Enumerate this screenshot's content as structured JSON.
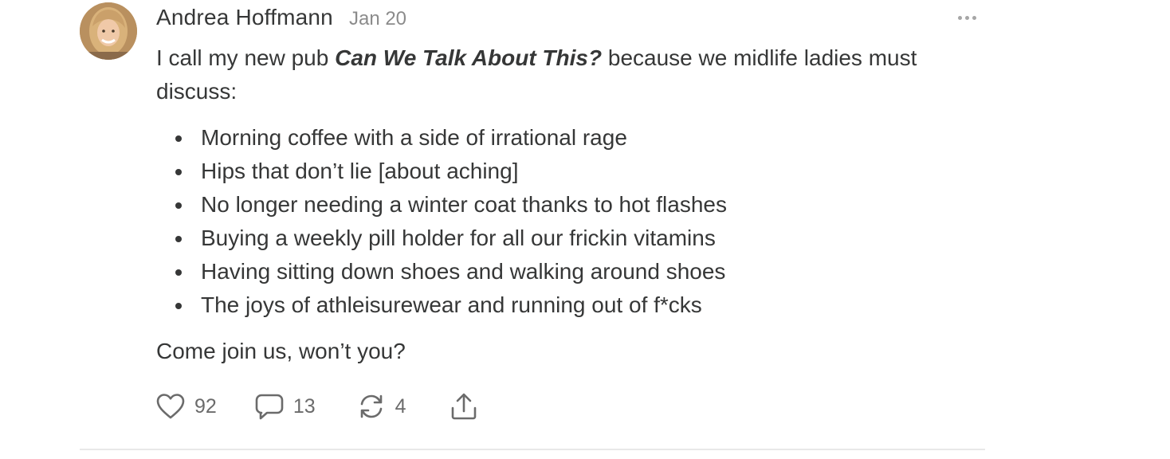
{
  "post": {
    "author": "Andrea Hoffmann",
    "date": "Jan 20",
    "avatar_icon": "user-avatar-photo",
    "more_icon": "more-horizontal-icon",
    "intro_before": "I call my new pub ",
    "intro_title": "Can We Talk About This?",
    "intro_after": " because we midlife ladies must discuss:",
    "topics": [
      "Morning coffee with a side of irrational rage",
      "Hips that don’t lie [about aching]",
      "No longer needing a winter coat thanks to hot flashes",
      "Buying a weekly pill holder for all our frickin vitamins",
      "Having sitting down shoes and walking around shoes",
      "The joys of athleisurewear and running out of f*cks"
    ],
    "outro": "Come join us, won’t you?"
  },
  "actions": {
    "likes": "92",
    "comments": "13",
    "restacks": "4",
    "like_icon": "heart-icon",
    "comment_icon": "comment-bubble-icon",
    "restack_icon": "restack-icon",
    "share_icon": "share-icon"
  },
  "colors": {
    "text": "#363737",
    "muted": "#8b8b8b",
    "icon": "#6b6b6b",
    "divider": "#e8e8e8"
  }
}
